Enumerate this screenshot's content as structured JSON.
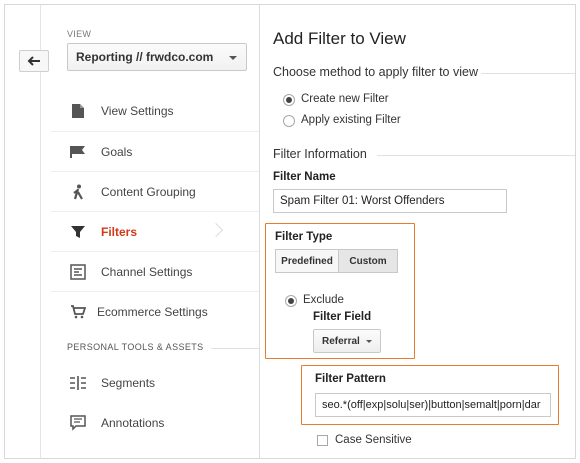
{
  "sidebar": {
    "view_label": "VIEW",
    "view_select": "Reporting // frwdco.com",
    "items": [
      {
        "label": "View Settings",
        "icon": "document-icon"
      },
      {
        "label": "Goals",
        "icon": "flag-icon"
      },
      {
        "label": "Content Grouping",
        "icon": "person-walking-icon"
      },
      {
        "label": "Filters",
        "icon": "funnel-icon",
        "active": true
      },
      {
        "label": "Channel Settings",
        "icon": "channel-icon"
      },
      {
        "label": "Ecommerce Settings",
        "icon": "cart-icon"
      }
    ],
    "section_personal": "PERSONAL TOOLS & ASSETS",
    "personal_items": [
      {
        "label": "Segments",
        "icon": "segments-icon"
      },
      {
        "label": "Annotations",
        "icon": "annotation-icon"
      }
    ]
  },
  "main": {
    "title": "Add Filter to View",
    "method_heading": "Choose method to apply filter to view",
    "method_options": [
      "Create new Filter",
      "Apply existing Filter"
    ],
    "method_selected": "Create new Filter",
    "info_heading": "Filter Information",
    "filter_name_label": "Filter Name",
    "filter_name_value": "Spam Filter 01: Worst Offenders",
    "filter_type_label": "Filter Type",
    "type_tabs": [
      "Predefined",
      "Custom"
    ],
    "type_selected": "Custom",
    "exclude_label": "Exclude",
    "filter_field_label": "Filter Field",
    "filter_field_value": "Referral",
    "filter_pattern_label": "Filter Pattern",
    "filter_pattern_value": "seo.*(off|exp|solu|ser)|button|semalt|porn|dar",
    "case_sensitive_label": "Case Sensitive"
  },
  "colors": {
    "active_nav": "#d0391a",
    "highlight_border": "#e97b2f"
  }
}
